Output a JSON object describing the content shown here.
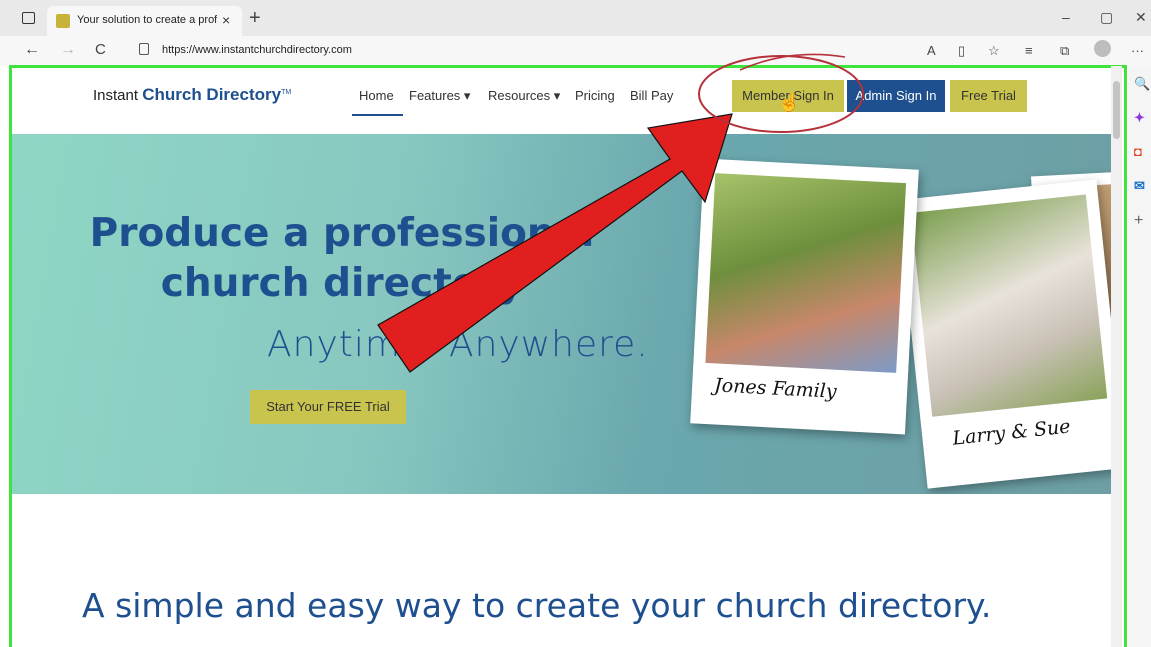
{
  "browser": {
    "tab_title": "Your solution to create a profess",
    "tab_close": "×",
    "new_tab": "+",
    "url": "https://www.instantchurchdirectory.com",
    "controls": {
      "minimize": "–",
      "restore": "▢",
      "close": "✕"
    },
    "nav": {
      "back": "←",
      "forward": "→",
      "refresh": "C"
    },
    "toolbar_icons": [
      "read-aloud-icon",
      "immersive-reader-icon",
      "favorite-add-icon",
      "favorites-icon",
      "collections-icon",
      "profile-icon",
      "more-icon"
    ],
    "toolbar_glyphs": {
      "read_aloud": "A",
      "immersive": "▯",
      "fav_add": "☆",
      "favorites": "≡",
      "collections": "⧉",
      "more": "···"
    }
  },
  "site": {
    "logo_prefix": "Instant ",
    "logo_brand": "Church Directory",
    "logo_tm": "TM",
    "nav": {
      "home": "Home",
      "features": "Features ▾",
      "resources": "Resources ▾",
      "pricing": "Pricing",
      "bill_pay": "Bill Pay"
    },
    "buttons": {
      "member_sign_in": "Member Sign In",
      "admin_sign_in": "Admin Sign In",
      "free_trial": "Free Trial"
    }
  },
  "hero": {
    "title_line1": "Produce a professional",
    "title_line2": "church directory",
    "subtitle": "Anytime. Anywhere.",
    "cta": "Start Your FREE Trial",
    "photo1_caption": "Jones Family",
    "photo2_caption": "Larry & Sue"
  },
  "main": {
    "tagline": "A simple and easy way to create your church directory."
  },
  "sidepanel": {
    "search": "🔍",
    "copilot": "✦",
    "office": "◘",
    "outlook": "✉",
    "add": "+"
  },
  "cursor": "☝",
  "colors": {
    "brand_blue": "#1e4f8f",
    "button_yellow": "#c9c44e",
    "highlight_green": "#3ee33c",
    "annotation_red": "#e11f1f"
  }
}
